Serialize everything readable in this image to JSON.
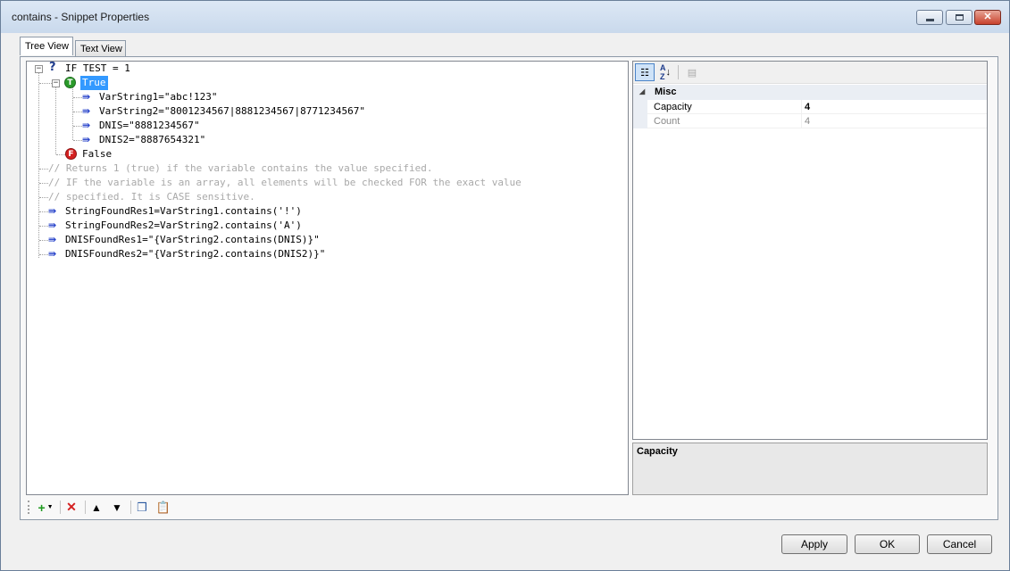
{
  "window": {
    "title": "contains - Snippet Properties",
    "minimize_label": "",
    "close_glyph": "✕"
  },
  "tabs": [
    {
      "label": "Tree View",
      "active": true
    },
    {
      "label": "Text View",
      "active": false
    }
  ],
  "tree": {
    "root": "IF TEST = 1",
    "true_node": "True",
    "true_icon": "T",
    "true_children": [
      "VarString1=\"abc!123\"",
      "VarString2=\"8001234567|8881234567|8771234567\"",
      "DNIS=\"8881234567\"",
      "DNIS2=\"8887654321\""
    ],
    "false_node": "False",
    "false_icon": "F",
    "comments": [
      "// Returns 1 (true) if the variable contains the value specified.",
      "// IF the variable is an array, all elements will be checked FOR the exact value",
      "// specified. It is CASE sensitive."
    ],
    "statements": [
      "StringFoundRes1=VarString1.contains('!')",
      "StringFoundRes2=VarString2.contains('A')",
      "DNISFoundRes1=\"{VarString2.contains(DNIS)}\"",
      "DNISFoundRes2=\"{VarString2.contains(DNIS2)}\""
    ]
  },
  "property_grid": {
    "category": "Misc",
    "rows": [
      {
        "name": "Capacity",
        "value": "4"
      },
      {
        "name": "Count",
        "value": "4"
      }
    ],
    "description_title": "Capacity"
  },
  "toolbar_icons": {
    "add": "add-icon",
    "delete": "delete-icon",
    "move_up": "move-up-icon",
    "move_down": "move-down-icon",
    "copy": "copy-icon",
    "paste": "paste-icon"
  },
  "buttons": {
    "apply": "Apply",
    "ok": "OK",
    "cancel": "Cancel"
  }
}
